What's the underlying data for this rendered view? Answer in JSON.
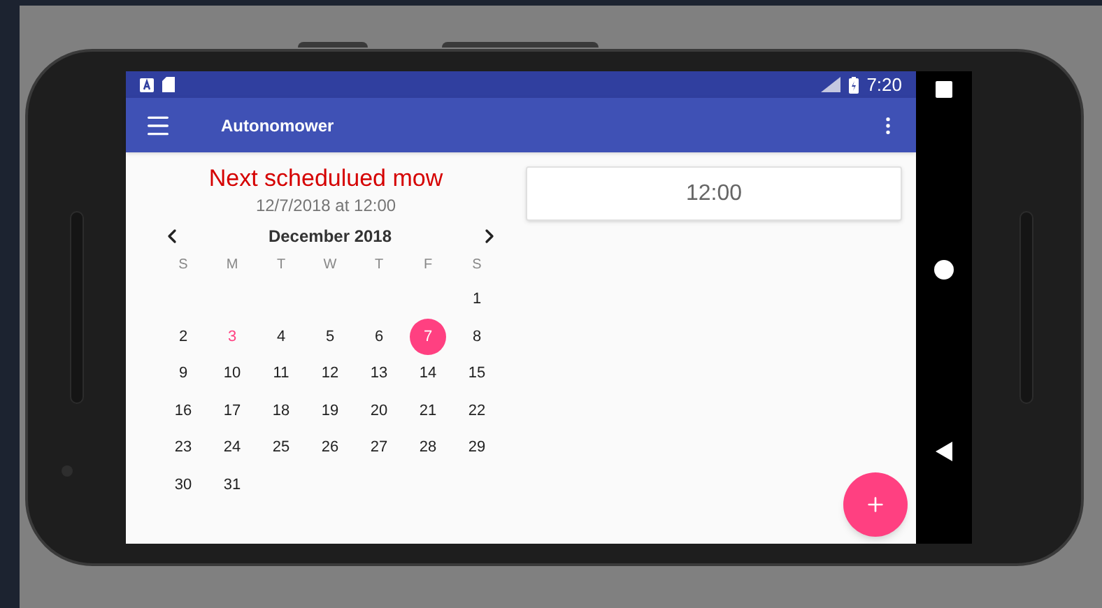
{
  "status_bar": {
    "time": "7:20"
  },
  "app_bar": {
    "title": "Autonomower"
  },
  "next_mow": {
    "heading": "Next schedulued mow",
    "subheading": "12/7/2018 at 12:00"
  },
  "calendar": {
    "month_label": "December 2018",
    "weekdays": [
      "S",
      "M",
      "T",
      "W",
      "T",
      "F",
      "S"
    ],
    "weeks": [
      [
        {
          "kind": "blank"
        },
        {
          "kind": "blank"
        },
        {
          "kind": "blank"
        },
        {
          "kind": "blank"
        },
        {
          "kind": "blank"
        },
        {
          "kind": "blank"
        },
        {
          "kind": "day",
          "label": "1",
          "selected": false,
          "today": false
        }
      ],
      [
        {
          "label": "2",
          "selected": false,
          "today": false
        },
        {
          "label": "3",
          "selected": false,
          "today": true
        },
        {
          "label": "4",
          "selected": false,
          "today": false
        },
        {
          "label": "5",
          "selected": false,
          "today": false
        },
        {
          "label": "6",
          "selected": false,
          "today": false
        },
        {
          "label": "7",
          "selected": true,
          "today": false
        },
        {
          "label": "8",
          "selected": false,
          "today": false
        }
      ],
      [
        {
          "label": "9",
          "selected": false,
          "today": false
        },
        {
          "label": "10",
          "selected": false,
          "today": false
        },
        {
          "label": "11",
          "selected": false,
          "today": false
        },
        {
          "label": "12",
          "selected": false,
          "today": false
        },
        {
          "label": "13",
          "selected": false,
          "today": false
        },
        {
          "label": "14",
          "selected": false,
          "today": false
        },
        {
          "label": "15",
          "selected": false,
          "today": false
        }
      ],
      [
        {
          "label": "16",
          "selected": false,
          "today": false
        },
        {
          "label": "17",
          "selected": false,
          "today": false
        },
        {
          "label": "18",
          "selected": false,
          "today": false
        },
        {
          "label": "19",
          "selected": false,
          "today": false
        },
        {
          "label": "20",
          "selected": false,
          "today": false
        },
        {
          "label": "21",
          "selected": false,
          "today": false
        },
        {
          "label": "22",
          "selected": false,
          "today": false
        }
      ],
      [
        {
          "label": "23",
          "selected": false,
          "today": false
        },
        {
          "label": "24",
          "selected": false,
          "today": false
        },
        {
          "label": "25",
          "selected": false,
          "today": false
        },
        {
          "label": "26",
          "selected": false,
          "today": false
        },
        {
          "label": "27",
          "selected": false,
          "today": false
        },
        {
          "label": "28",
          "selected": false,
          "today": false
        },
        {
          "label": "29",
          "selected": false,
          "today": false
        }
      ],
      [
        {
          "label": "30",
          "selected": false,
          "today": false
        },
        {
          "label": "31",
          "selected": false,
          "today": false
        },
        {
          "kind": "blank"
        },
        {
          "kind": "blank"
        },
        {
          "kind": "blank"
        },
        {
          "kind": "blank"
        },
        {
          "kind": "blank"
        }
      ]
    ]
  },
  "time_field": {
    "value": "12:00"
  }
}
